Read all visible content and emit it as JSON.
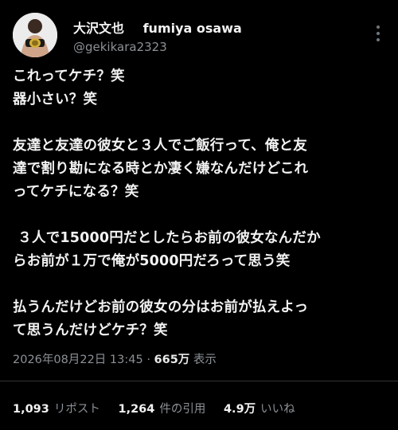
{
  "author": {
    "display_name": "大沢文也",
    "english_name": "fumiya osawa",
    "handle": "@gekikara2323"
  },
  "tweet": {
    "paragraphs": [
      [
        "これってケチ？笑",
        "器小さい？笑"
      ],
      [
        "友達と友達の彼女と３人でご飯行って、俺と友",
        "達で割り勘になる時とか凄く嫌なんだけどこれ",
        "ってケチになる？笑"
      ],
      [
        " ３人で15000円だとしたらお前の彼女なんだか",
        "らお前が１万で俺が5000円だろって思う笑"
      ],
      [
        "払うんだけどお前の彼女の分はお前が払えよっ",
        "て思うんだけどケチ？笑"
      ]
    ]
  },
  "meta": {
    "timestamp": "2026年08月22日 13:45",
    "separator": "·",
    "views_count": "665万",
    "views_label": "表示"
  },
  "stats": {
    "reposts_count": "1,093",
    "reposts_label": "リポスト",
    "quotes_count": "1,264",
    "quotes_label": "件の引用",
    "likes_count": "4.9万",
    "likes_label": "いいね"
  },
  "icons": {
    "more": "more-vertical-icon"
  }
}
